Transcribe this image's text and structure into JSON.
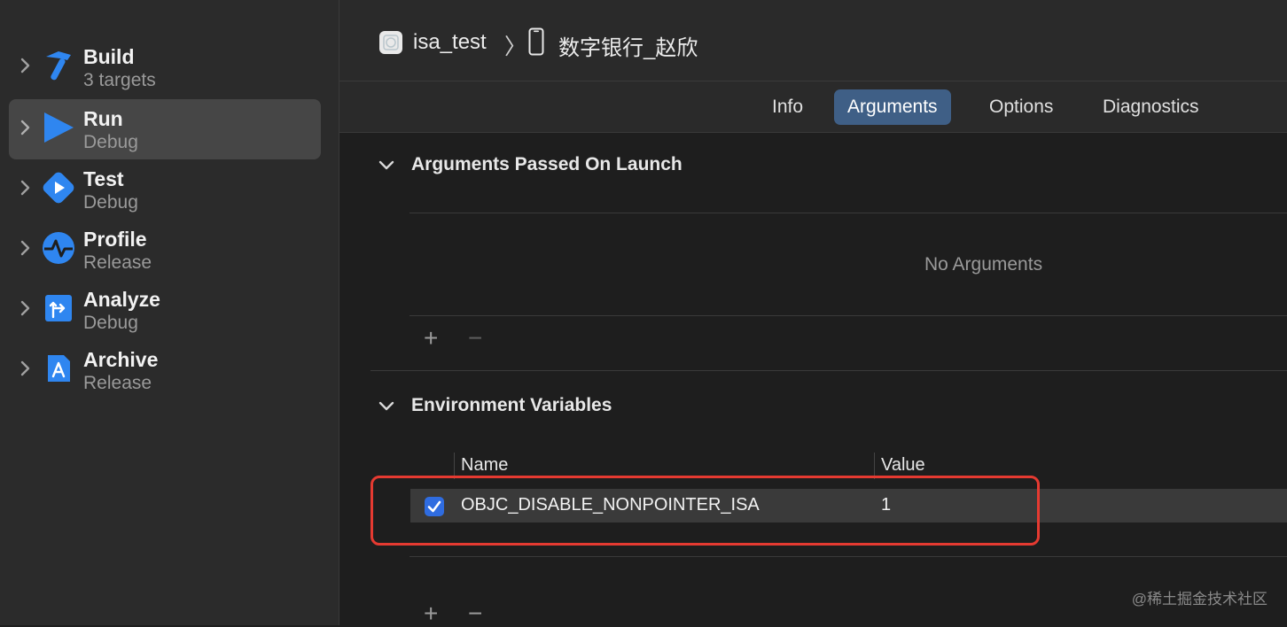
{
  "sidebar": {
    "items": [
      {
        "title": "Build",
        "subtitle": "3 targets",
        "icon": "hammer-icon"
      },
      {
        "title": "Run",
        "subtitle": "Debug",
        "icon": "play-icon",
        "selected": true
      },
      {
        "title": "Test",
        "subtitle": "Debug",
        "icon": "test-diamond-icon"
      },
      {
        "title": "Profile",
        "subtitle": "Release",
        "icon": "waveform-icon"
      },
      {
        "title": "Analyze",
        "subtitle": "Debug",
        "icon": "analyze-icon"
      },
      {
        "title": "Archive",
        "subtitle": "Release",
        "icon": "archive-icon"
      }
    ]
  },
  "header": {
    "scheme": "isa_test",
    "separator": "〉",
    "device": "数字银行_赵欣"
  },
  "tabs": [
    {
      "label": "Info"
    },
    {
      "label": "Arguments",
      "active": true
    },
    {
      "label": "Options"
    },
    {
      "label": "Diagnostics"
    }
  ],
  "arguments": {
    "title": "Arguments Passed On Launch",
    "empty_text": "No Arguments",
    "add": "+",
    "remove": "−"
  },
  "environment": {
    "title": "Environment Variables",
    "columns": {
      "name": "Name",
      "value": "Value"
    },
    "rows": [
      {
        "name": "OBJC_DISABLE_NONPOINTER_ISA",
        "value": "1",
        "enabled": true
      }
    ],
    "add": "+",
    "remove": "−"
  },
  "watermark": "@稀土掘金技术社区",
  "colors": {
    "accent": "#2f7fe6",
    "highlight": "#e53a31",
    "tab_active": "#3f5f86"
  }
}
